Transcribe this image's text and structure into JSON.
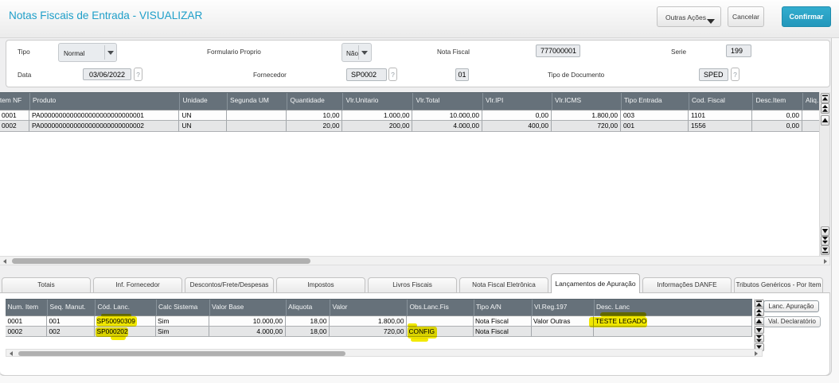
{
  "header": {
    "title": "Notas Fiscais de Entrada - VISUALIZAR",
    "outras_acoes_label": "Outras Ações",
    "cancelar_label": "Cancelar",
    "confirmar_label": "Confirmar"
  },
  "form": {
    "tipo": {
      "label": "Tipo",
      "value": "Normal"
    },
    "formulario_proprio": {
      "label": "Formulario Proprio",
      "value": "Não"
    },
    "nota_fiscal": {
      "label": "Nota Fiscal",
      "value": "777000001"
    },
    "serie": {
      "label": "Serie",
      "value": "199"
    },
    "data": {
      "label": "Data",
      "value": "03/06/2022",
      "help": "?"
    },
    "fornecedor": {
      "label": "Fornecedor",
      "value": "SP0002",
      "help": "?"
    },
    "loja": {
      "value": "01"
    },
    "tipo_documento": {
      "label": "Tipo de Documento",
      "value": "SPED",
      "help": "?"
    }
  },
  "items_grid": {
    "columns": [
      "Item NF",
      "Produto",
      "Unidade",
      "Segunda UM",
      "Quantidade",
      "Vlr.Unitario",
      "Vlr.Total",
      "Vlr.IPI",
      "Vlr.ICMS",
      "Tipo Entrada",
      "Cod. Fiscal",
      "Desc.Item",
      "Aliq. I"
    ],
    "rows": [
      [
        "0001",
        "PA0000000000000000000000000001",
        "UN",
        "",
        "10,00",
        "1.000,00",
        "10.000,00",
        "0,00",
        "1.800,00",
        "003",
        "1101",
        "0,00",
        ""
      ],
      [
        "0002",
        "PA0000000000000000000000000002",
        "UN",
        "",
        "20,00",
        "200,00",
        "4.000,00",
        "400,00",
        "720,00",
        "001",
        "1556",
        "0,00",
        ""
      ]
    ]
  },
  "tabs": [
    {
      "label": "Totais",
      "active": false
    },
    {
      "label": "Inf. Fornecedor",
      "active": false
    },
    {
      "label": "Descontos/Frete/Despesas",
      "active": false
    },
    {
      "label": "Impostos",
      "active": false
    },
    {
      "label": "Livros Fiscais",
      "active": false
    },
    {
      "label": "Nota Fiscal Eletrônica",
      "active": false
    },
    {
      "label": "Lançamentos de Apuração",
      "active": true
    },
    {
      "label": "Informações DANFE",
      "active": false
    },
    {
      "label": "Tributos Genéricos - Por Item",
      "active": false
    }
  ],
  "apuracao_grid": {
    "columns": [
      "Num. Item",
      "Seq. Manut.",
      "Cód. Lanc.",
      "Calc Sistema",
      "Valor Base",
      "Aliquota",
      "Valor",
      "Obs.Lanc.Fis",
      "Tipo A/N",
      "Vl.Reg.197",
      "Desc. Lanc"
    ],
    "rows": [
      [
        "0001",
        "001",
        "SP50090309",
        "Sim",
        "10.000,00",
        "18,00",
        "1.800,00",
        "",
        "Nota Fiscal",
        "Valor Outras",
        "TESTE LEGADO"
      ],
      [
        "0002",
        "002",
        "SP000202",
        "Sim",
        "4.000,00",
        "18,00",
        "720,00",
        "CONFIG",
        "Nota Fiscal",
        "",
        ""
      ]
    ],
    "highlighted_cells": [
      [
        0,
        2
      ],
      [
        0,
        10
      ],
      [
        1,
        2
      ],
      [
        1,
        7
      ]
    ]
  },
  "side_buttons": {
    "lanc_apuracao": "Lanc. Apuração",
    "val_declaratorio": "Val. Declaratório"
  },
  "colors": {
    "accent": "#28a5c8",
    "title": "#1f9fc9",
    "grid_header": "#66717a",
    "highlight": "#f2e900"
  }
}
